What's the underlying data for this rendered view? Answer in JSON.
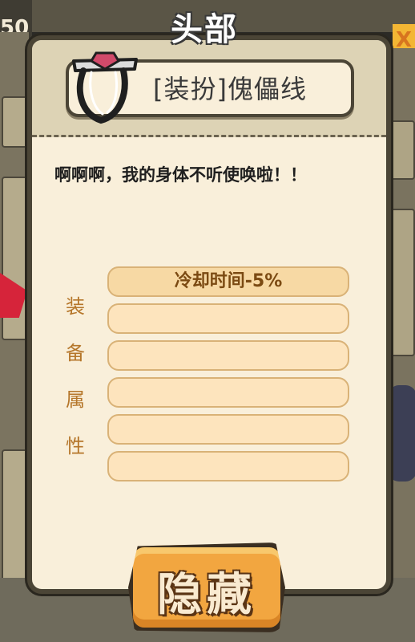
{
  "background": {
    "left_stat": "50",
    "right_badge": "X"
  },
  "slot": {
    "title": "头部"
  },
  "item": {
    "name": "[装扮]傀儡线",
    "icon": "puppet-string-icon",
    "description": "啊啊啊，我的身体不听使唤啦！！"
  },
  "attributes": {
    "label_chars": [
      "装",
      "备",
      "属",
      "性"
    ],
    "rows": [
      "冷却时间-5%",
      "",
      "",
      "",
      "",
      ""
    ]
  },
  "buttons": {
    "hide_label": "隐藏"
  },
  "colors": {
    "panel_bg": "#f9efda",
    "panel_border": "#4b4536",
    "attr_text": "#7b4a12",
    "attr_label": "#b5762a",
    "button_fill": "#f2a640"
  }
}
